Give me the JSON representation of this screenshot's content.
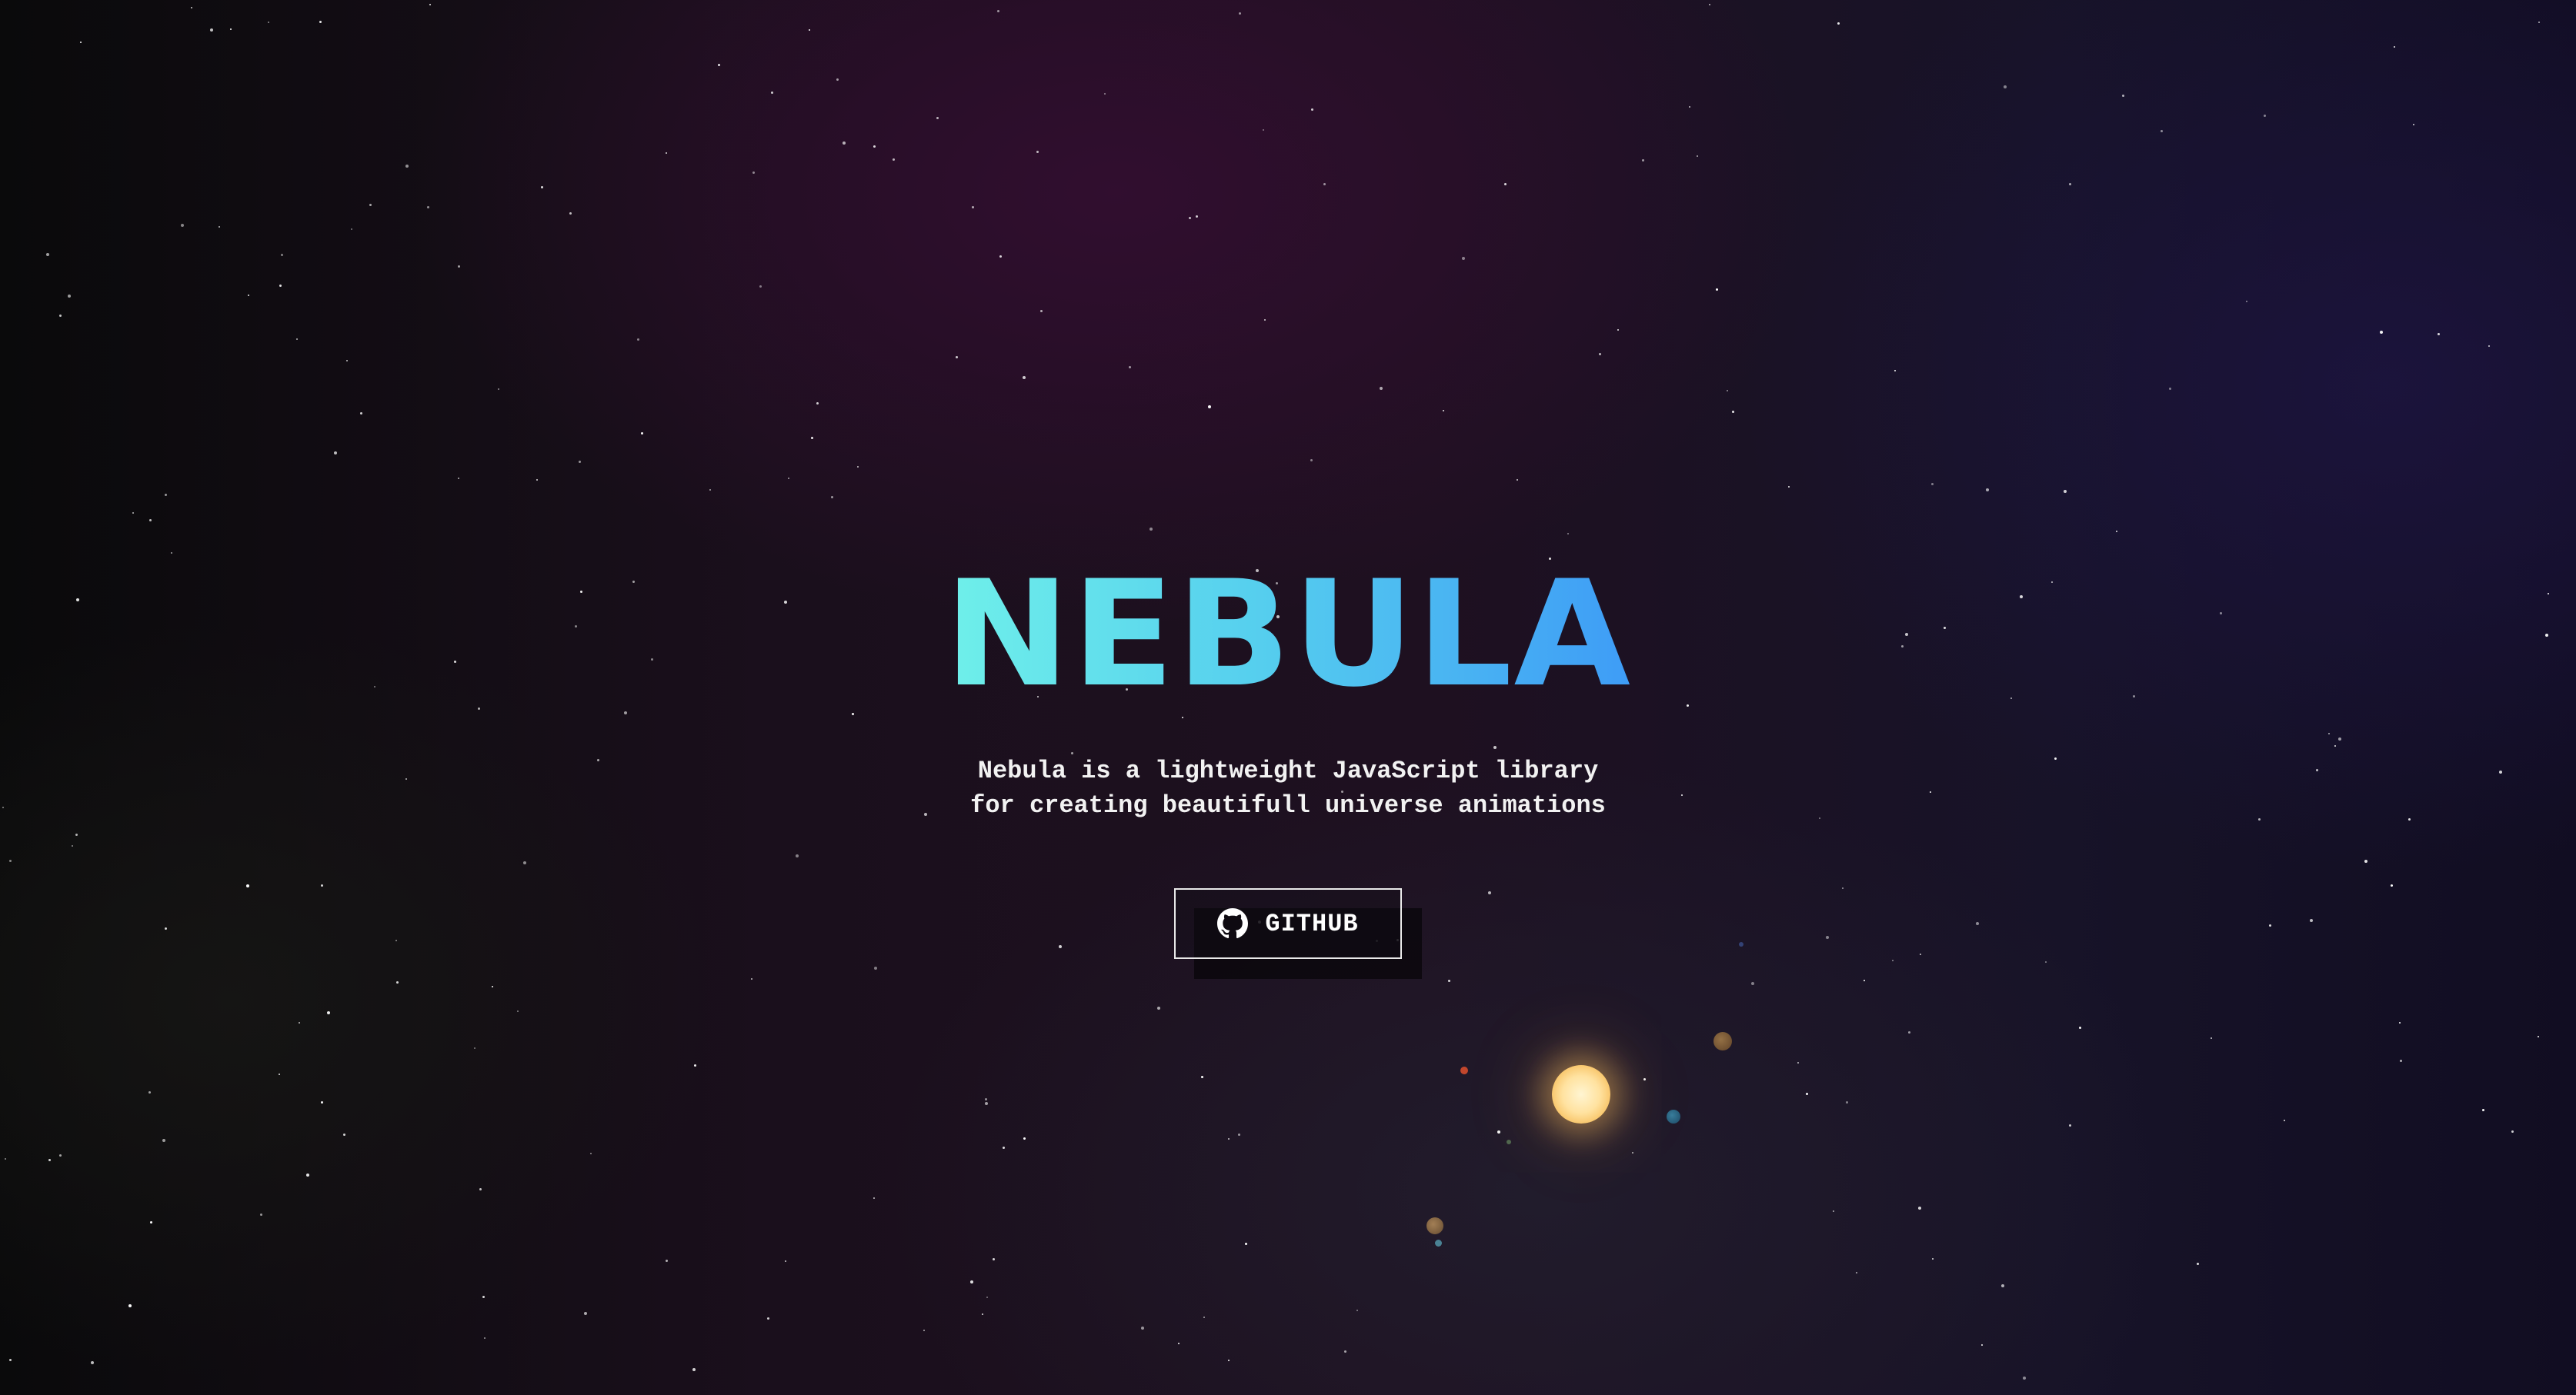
{
  "hero": {
    "title": "NEBULA",
    "subtitle_line1": "Nebula is a lightweight JavaScript library",
    "subtitle_line2": "for creating beautifull universe animations"
  },
  "actions": {
    "github_label": "GITHUB"
  },
  "icons": {
    "github": "github-icon"
  },
  "colors": {
    "title_gradient_start": "#6ff0ea",
    "title_gradient_end": "#3e9cf6",
    "sun": "#ffe2a0",
    "button_border": "#e9e9e9"
  }
}
